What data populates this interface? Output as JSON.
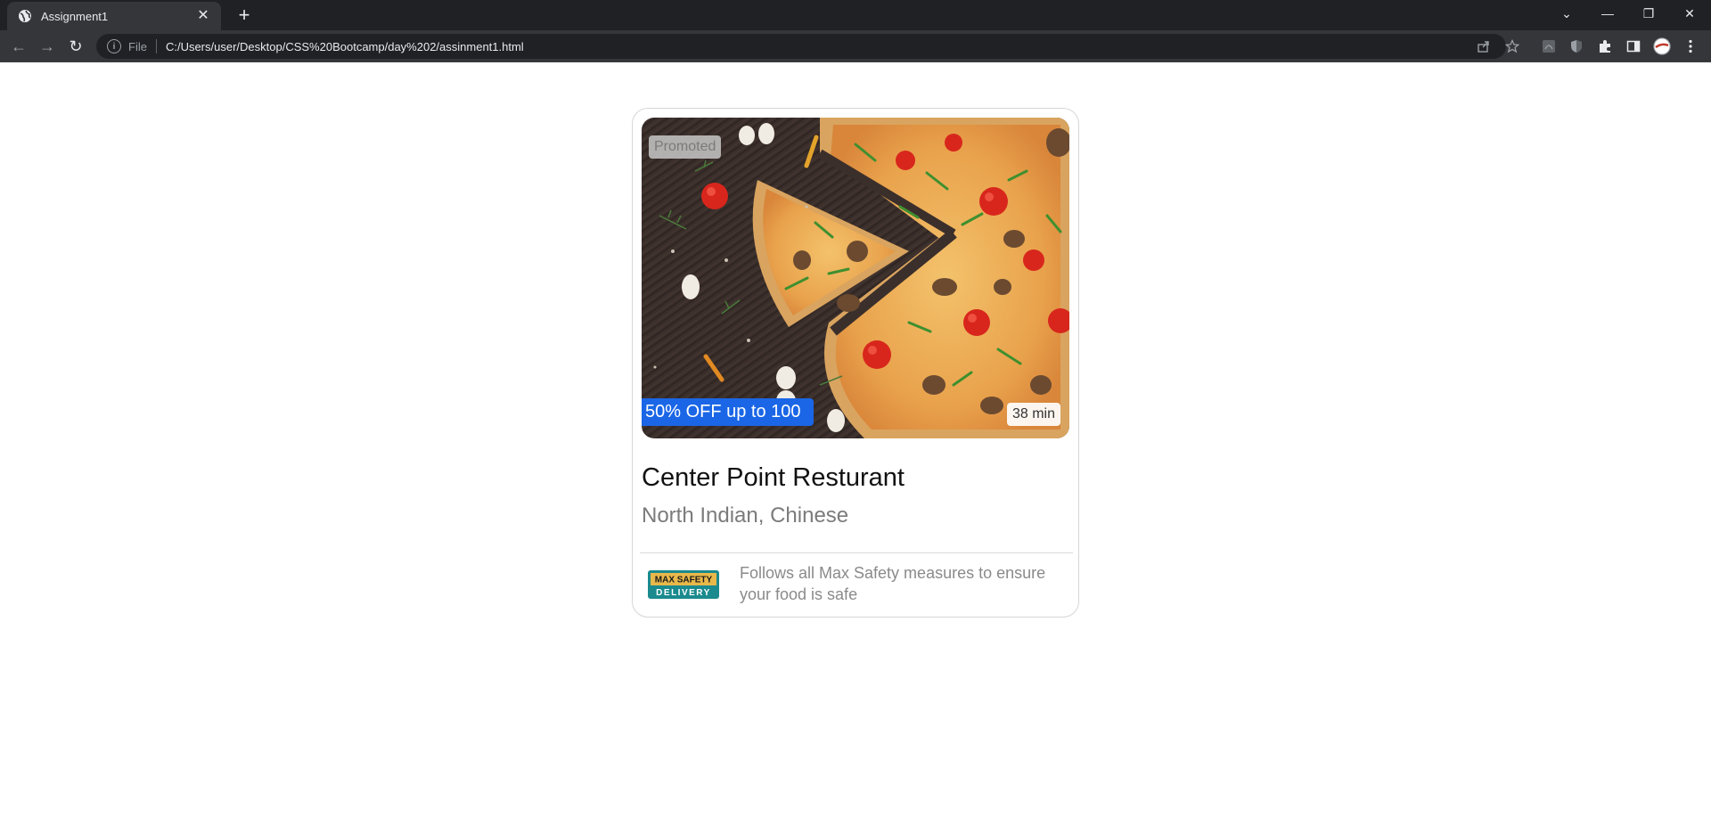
{
  "browser": {
    "tab_title": "Assignment1",
    "tab_close": "✕",
    "new_tab": "+",
    "omnibox": {
      "info_glyph": "i",
      "scheme_label": "File",
      "url": "C:/Users/user/Desktop/CSS%20Bootcamp/day%202/assinment1.html"
    },
    "nav": {
      "back": "←",
      "forward": "→",
      "reload": "↻"
    },
    "window_controls": {
      "tab_search": "⌄",
      "minimize": "—",
      "restore": "❐",
      "close": "✕"
    },
    "toolbar_icons": [
      "share-icon",
      "star-icon",
      "pdf-extension-icon",
      "shield-extension-icon",
      "puzzle-extensions-icon",
      "side-panel-icon",
      "profile-avatar",
      "menu-icon"
    ]
  },
  "card": {
    "promoted_label": "Promoted",
    "offer_label": "50% OFF up to 100",
    "delivery_time": "38 min",
    "restaurant_name": "Center Point Resturant",
    "cuisines": "North Indian, Chinese",
    "safety_logo": {
      "line1": "MAX SAFETY",
      "line2": "DELIVERY"
    },
    "safety_text": "Follows all Max Safety measures to ensure your food is safe",
    "colors": {
      "offer_badge": "#1a66e6",
      "border": "#d6d6d6",
      "safety_teal": "#1a8a8e",
      "safety_gold": "#e8b84a"
    }
  }
}
